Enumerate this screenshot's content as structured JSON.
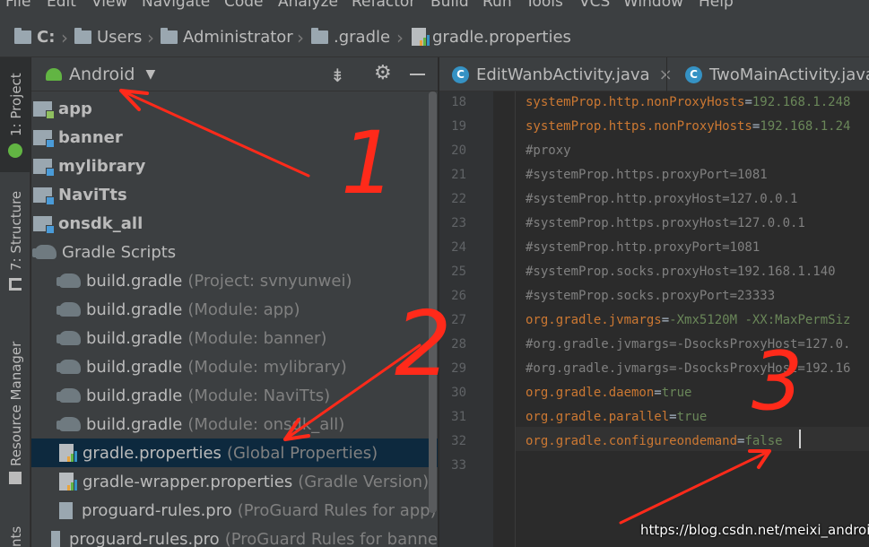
{
  "menubar": {
    "items": [
      "File",
      "Edit",
      "View",
      "Navigate",
      "Code",
      "Analyze",
      "Refactor",
      "Build",
      "Run",
      "Tools",
      "VCS",
      "Window",
      "Help"
    ]
  },
  "breadcrumb": {
    "items": [
      "C:",
      "Users",
      "Administrator",
      ".gradle",
      "gradle.properties"
    ]
  },
  "left_toolbar": {
    "tabs": [
      "1: Project",
      "7: Structure",
      "Resource Manager",
      "nts"
    ]
  },
  "project_panel": {
    "view_selector": "Android",
    "tree": [
      {
        "label": "app",
        "hint": ""
      },
      {
        "label": "banner",
        "hint": ""
      },
      {
        "label": "mylibrary",
        "hint": ""
      },
      {
        "label": "NaviTts",
        "hint": ""
      },
      {
        "label": "onsdk_all",
        "hint": ""
      },
      {
        "label": "Gradle Scripts",
        "hint": ""
      },
      {
        "label": "build.gradle",
        "hint": "(Project: svnyunwei)"
      },
      {
        "label": "build.gradle",
        "hint": "(Module: app)"
      },
      {
        "label": "build.gradle",
        "hint": "(Module: banner)"
      },
      {
        "label": "build.gradle",
        "hint": "(Module: mylibrary)"
      },
      {
        "label": "build.gradle",
        "hint": "(Module: NaviTts)"
      },
      {
        "label": "build.gradle",
        "hint": "(Module: onsdk_all)"
      },
      {
        "label": "gradle.properties",
        "hint": "(Global Properties)"
      },
      {
        "label": "gradle-wrapper.properties",
        "hint": "(Gradle Version)"
      },
      {
        "label": "proguard-rules.pro",
        "hint": "(ProGuard Rules for app)"
      },
      {
        "label": "proguard-rules.pro",
        "hint": "(ProGuard Rules for banne"
      }
    ]
  },
  "editor": {
    "tabs": [
      {
        "label": "EditWanbActivity.java",
        "close": "×"
      },
      {
        "label": "TwoMainActivity.java",
        "close": ""
      }
    ],
    "lines": [
      {
        "num": "18",
        "key": "systemProp.http.nonProxyHosts",
        "eq": "=",
        "val": "192.168.1.248",
        "comment": false
      },
      {
        "num": "19",
        "key": "systemProp.https.nonProxyHosts",
        "eq": "=",
        "val": "192.168.1.24",
        "comment": false
      },
      {
        "num": "20",
        "key": "#proxy",
        "eq": "",
        "val": "",
        "comment": true
      },
      {
        "num": "21",
        "key": "#systemProp.https.proxyPort=1081",
        "eq": "",
        "val": "",
        "comment": true
      },
      {
        "num": "22",
        "key": "#systemProp.http.proxyHost=127.0.0.1",
        "eq": "",
        "val": "",
        "comment": true
      },
      {
        "num": "23",
        "key": "#systemProp.https.proxyHost=127.0.0.1",
        "eq": "",
        "val": "",
        "comment": true
      },
      {
        "num": "24",
        "key": "#systemProp.http.proxyPort=1081",
        "eq": "",
        "val": "",
        "comment": true
      },
      {
        "num": "25",
        "key": "#systemProp.socks.proxyHost=192.168.1.140",
        "eq": "",
        "val": "",
        "comment": true
      },
      {
        "num": "26",
        "key": "#systemProp.socks.proxyPort=23333",
        "eq": "",
        "val": "",
        "comment": true
      },
      {
        "num": "27",
        "key": "org.gradle.jvmargs",
        "eq": "=",
        "val": "-Xmx5120M -XX:MaxPermSiz",
        "comment": false
      },
      {
        "num": "28",
        "key": "#org.gradle.jvmargs=-DsocksProxyHost=127.0.",
        "eq": "",
        "val": "",
        "comment": true
      },
      {
        "num": "29",
        "key": "#org.gradle.jvmargs=-DsocksProxyHost=192.16",
        "eq": "",
        "val": "",
        "comment": true
      },
      {
        "num": "30",
        "key": "org.gradle.daemon",
        "eq": "=",
        "val": "true",
        "comment": false
      },
      {
        "num": "31",
        "key": "org.gradle.parallel",
        "eq": "=",
        "val": "true",
        "comment": false
      },
      {
        "num": "32",
        "key": "org.gradle.configureondemand",
        "eq": "=",
        "val": "false",
        "comment": false
      },
      {
        "num": "33",
        "key": "",
        "eq": "",
        "val": "",
        "comment": false
      }
    ]
  },
  "annotations": {
    "marks": [
      "1",
      "2",
      "3"
    ],
    "watermark": "https://blog.csdn.net/meixi_android"
  },
  "colors": {
    "accent": "#3592c4",
    "selection": "#0d293e",
    "annotation": "#ff2a1a",
    "keyword": "#cc7832",
    "value": "#6a8759",
    "comment": "#808080"
  }
}
